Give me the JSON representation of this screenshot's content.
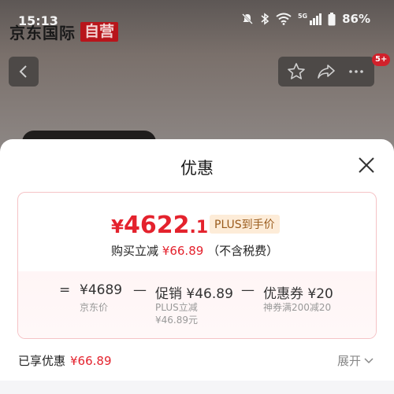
{
  "status_bar": {
    "time": "15:13",
    "battery": "86%",
    "network": "5G"
  },
  "brand": {
    "name": "京东国际",
    "badge": "自营"
  },
  "nav": {
    "notification_count": "5+"
  },
  "sheet": {
    "title": "优惠",
    "final_price": {
      "currency": "¥",
      "integer": "4622",
      "decimal": ".11",
      "tag": "PLUS到手价"
    },
    "buy_line": {
      "prefix": "购买立减",
      "amount": "¥66.89",
      "suffix": "（不含税费）"
    },
    "calc": {
      "eq": "=",
      "price": "¥4689",
      "price_label": "京东价",
      "minus1": "—",
      "promo": "促销 ¥46.89",
      "promo_sub1": "PLUS立减",
      "promo_sub2": "¥46.89元",
      "minus2": "—",
      "coupon": "优惠券 ¥20",
      "coupon_sub": "神券满200减20"
    },
    "enjoyed_label": "已享优惠",
    "enjoyed_amount": "¥66.89",
    "expand_label": "展开"
  },
  "colors": {
    "accent_red": "#e4222d",
    "plus_tag_bg": "#fdecd8",
    "plus_tag_text": "#9a5b1c"
  }
}
